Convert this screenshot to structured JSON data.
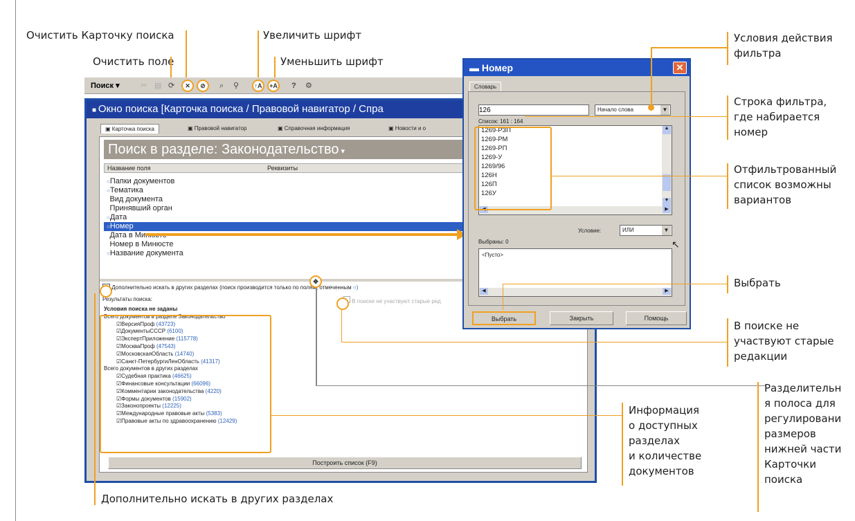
{
  "annotations": {
    "clear_card": "Очистить Карточку поиска",
    "clear_field": "Очистить поле",
    "increase_font": "Увеличить шрифт",
    "decrease_font": "Уменьшить шрифт",
    "filter_cond": [
      "Условия действия",
      "фильтра"
    ],
    "filter_row": [
      "Строка фильтра,",
      "где набирается",
      "номер"
    ],
    "filtered_list": [
      "Отфильтрованный",
      "список возможны",
      "вариантов"
    ],
    "select": "Выбрать",
    "old_editions": [
      "В поиске не",
      "участвуют старые",
      "редакции"
    ],
    "splitter": [
      "Разделительн",
      "я полоса для",
      "регулировани",
      "размеров",
      "нижней части",
      "Карточки",
      "поиска"
    ],
    "sections_info": [
      "Информация",
      "о доступных",
      "разделах",
      "и количестве",
      "документов"
    ],
    "also_search": "Дополнительно искать в других разделах"
  },
  "toolbar": {
    "search_btn": "Поиск ▾",
    "font_up": "↑A",
    "font_down": "+A"
  },
  "main_window": {
    "title": "Окно поиска [Карточка поиска / Правовой навигатор / Спра",
    "tabs": [
      "Карточка поиска",
      "Правовой навигатор",
      "Справочная информация",
      "Новости и о"
    ],
    "heading": "Поиск в разделе: Законодательство",
    "col_name": "Название поля",
    "col_req": "Реквизиты",
    "fields": [
      {
        "label": "Папки документов",
        "dot": true
      },
      {
        "label": "Тематика",
        "dot": true
      },
      {
        "label": "Вид документа",
        "dot": false
      },
      {
        "label": "Принявший орган",
        "dot": false
      },
      {
        "label": "Дата",
        "dot": true
      },
      {
        "label": "Номер",
        "dot": true,
        "selected": true
      },
      {
        "label": "Дата в Минюсте",
        "dot": false
      },
      {
        "label": "Номер в Минюсте",
        "dot": false
      },
      {
        "label": "Название документа",
        "dot": true
      }
    ],
    "also_search_text": "Дополнительно искать в других разделах (поиск производится только по полям, отмеченным",
    "results_label": "Результаты поиска:",
    "old_editions_text": "В поиске не участвуют старые ред",
    "conditions_none": "Условия поиска не заданы",
    "total_in_section": "Всего документов в разделе Законодательство",
    "section_items": [
      {
        "name": "ВерсияПроф",
        "count": "(43723)"
      },
      {
        "name": "ДокументыСССР",
        "count": "(6100)"
      },
      {
        "name": "ЭкспертПриложение",
        "count": "(115778)"
      },
      {
        "name": "МоскваПроф",
        "count": "(47543)"
      },
      {
        "name": "МосковскаяОбласть",
        "count": "(14740)"
      },
      {
        "name": "Санкт-ПетербургиЛенОбласть",
        "count": "(41317)"
      }
    ],
    "total_other": "Всего документов в других разделах",
    "other_items": [
      {
        "name": "Судебная практика",
        "count": "(46625)"
      },
      {
        "name": "Финансовые консультации",
        "count": "(66096)"
      },
      {
        "name": "Комментарии законодательства",
        "count": "(4220)"
      },
      {
        "name": "Формы документов",
        "count": "(15902)"
      },
      {
        "name": "Законопроекты",
        "count": "(12225)"
      },
      {
        "name": "Международные правовые акты",
        "count": "(5383)"
      },
      {
        "name": "Правовые акты по здравоохранению",
        "count": "(12429)"
      }
    ],
    "build_list": "Построить список (F9)"
  },
  "dialog": {
    "title": "Номер",
    "tab": "Словарь",
    "filter_value": "126",
    "filter_mode": "Начало слова",
    "list_count": "Список: 161 : 164",
    "list_items": [
      "1269-РЗП",
      "1269-РМ",
      "1269-РП",
      "1269-У",
      "1269/96",
      "126Н",
      "126П",
      "126У"
    ],
    "condition_label": "Условие:",
    "condition_value": "ИЛИ",
    "selected_label": "Выбраны: 0",
    "selected_empty": "<Пусто>",
    "btn_select": "Выбрать",
    "btn_close": "Закрыть",
    "btn_help": "Помощь"
  }
}
